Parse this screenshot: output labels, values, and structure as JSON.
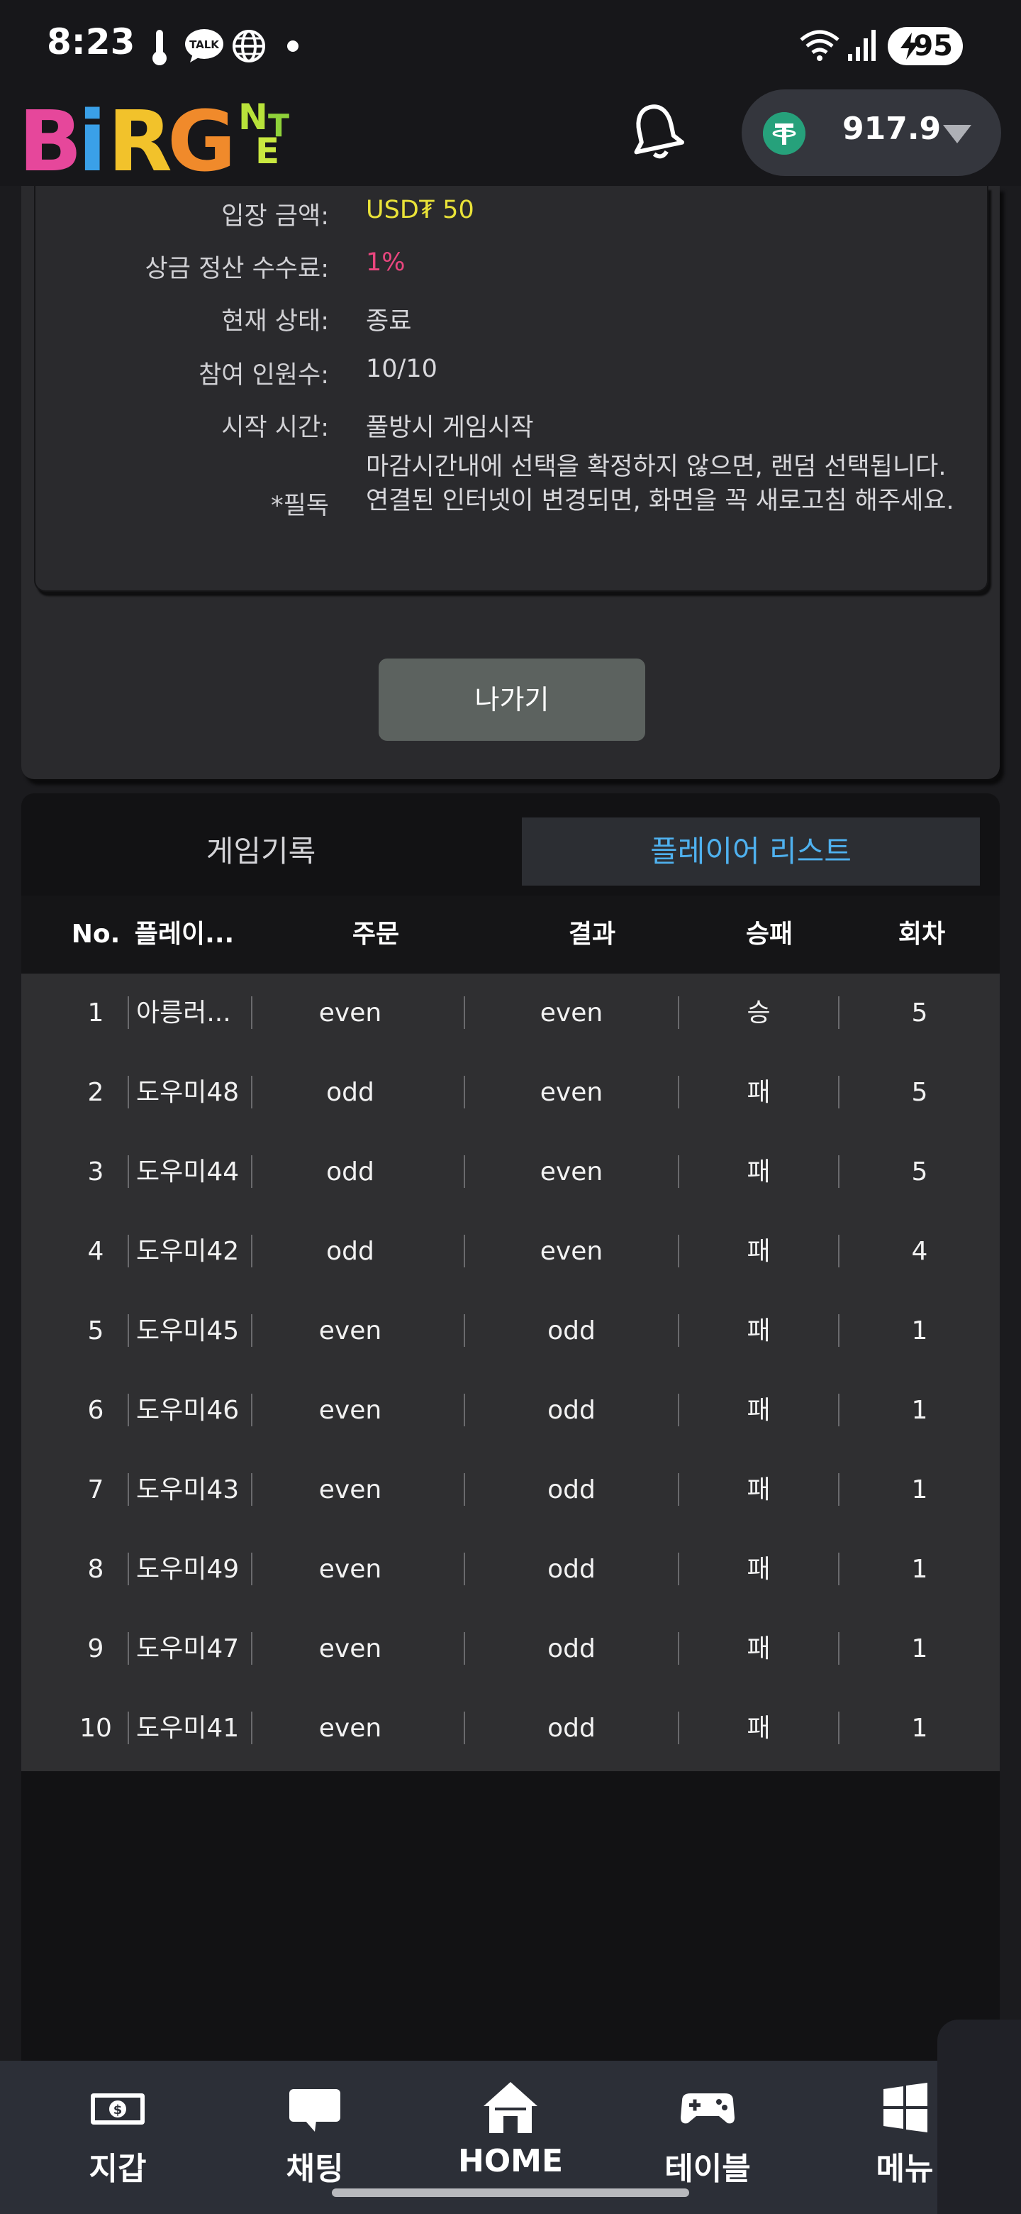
{
  "status_bar": {
    "time": "8:23",
    "battery": "95"
  },
  "header": {
    "logo_text": "BiRGoNET",
    "balance": "917.9"
  },
  "info": {
    "rows": [
      {
        "label": "입장 금액:",
        "value": "USD₮ 50"
      },
      {
        "label": "상금 정산 수수료:",
        "value": "1%"
      },
      {
        "label": "현재 상태:",
        "value": "종료"
      },
      {
        "label": "참여 인원수:",
        "value": "10/10"
      },
      {
        "label": "시작 시간:",
        "value": "풀방시 게임시작"
      }
    ],
    "note_label": "*필독",
    "note": "마감시간내에 선택을 확정하지 않으면, 랜덤 선택됩니다. 연결된 인터넷이 변경되면, 화면을 꼭 새로고침 해주세요."
  },
  "exit_button": "나가기",
  "tabs": {
    "records": "게임기록",
    "players": "플레이어 리스트"
  },
  "table": {
    "headers": [
      "No.",
      "플레이...",
      "주문",
      "결과",
      "승패",
      "회차"
    ],
    "rows": [
      {
        "no": "1",
        "player": "아릉러...",
        "order": "even",
        "result": "even",
        "outcome": "승",
        "round": "5"
      },
      {
        "no": "2",
        "player": "도우미48",
        "order": "odd",
        "result": "even",
        "outcome": "패",
        "round": "5"
      },
      {
        "no": "3",
        "player": "도우미44",
        "order": "odd",
        "result": "even",
        "outcome": "패",
        "round": "5"
      },
      {
        "no": "4",
        "player": "도우미42",
        "order": "odd",
        "result": "even",
        "outcome": "패",
        "round": "4"
      },
      {
        "no": "5",
        "player": "도우미45",
        "order": "even",
        "result": "odd",
        "outcome": "패",
        "round": "1"
      },
      {
        "no": "6",
        "player": "도우미46",
        "order": "even",
        "result": "odd",
        "outcome": "패",
        "round": "1"
      },
      {
        "no": "7",
        "player": "도우미43",
        "order": "even",
        "result": "odd",
        "outcome": "패",
        "round": "1"
      },
      {
        "no": "8",
        "player": "도우미49",
        "order": "even",
        "result": "odd",
        "outcome": "패",
        "round": "1"
      },
      {
        "no": "9",
        "player": "도우미47",
        "order": "even",
        "result": "odd",
        "outcome": "패",
        "round": "1"
      },
      {
        "no": "10",
        "player": "도우미41",
        "order": "even",
        "result": "odd",
        "outcome": "패",
        "round": "1"
      }
    ]
  },
  "nav": [
    {
      "label": "지갑",
      "icon": "wallet-icon"
    },
    {
      "label": "채팅",
      "icon": "chat-icon"
    },
    {
      "label": "HOME",
      "icon": "home-icon"
    },
    {
      "label": "테이블",
      "icon": "gamepad-icon"
    },
    {
      "label": "메뉴",
      "icon": "menu-grid-icon"
    }
  ],
  "colors": {
    "accent": "#4fb1ef",
    "fee": "#e9467e",
    "entry": "#e9e238"
  }
}
